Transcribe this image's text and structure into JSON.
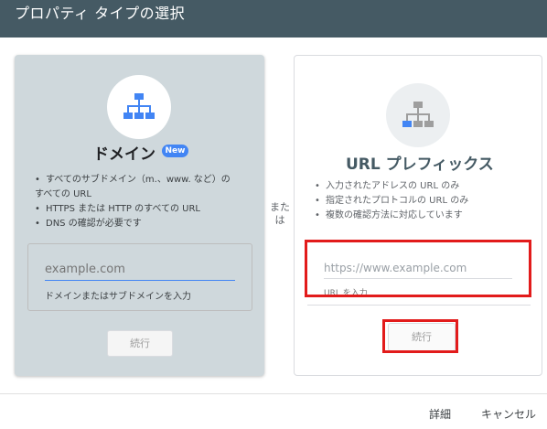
{
  "dialog": {
    "title": "プロパティ タイプの選択"
  },
  "domain_card": {
    "title": "ドメイン",
    "badge": "New",
    "bullets": [
      [
        "すべてのサブドメイン（m.、www. など）の",
        "すべての URL"
      ],
      "HTTPS または HTTP のすべての URL",
      "DNS の確認が必要です"
    ],
    "input_placeholder": "example.com",
    "input_value": "",
    "helper": "ドメインまたはサブドメインを入力",
    "continue_label": "続行"
  },
  "separator": {
    "line1": "また",
    "line2": "は"
  },
  "url_card": {
    "title": "URL プレフィックス",
    "bullets": [
      "入力されたアドレスの URL のみ",
      "指定されたプロトコルの URL のみ",
      "複数の確認方法に対応しています"
    ],
    "input_placeholder": "https://www.example.com",
    "input_value": "",
    "helper": "URL を入力",
    "continue_label": "続行"
  },
  "footer": {
    "details_label": "詳細",
    "cancel_label": "キャンセル"
  },
  "icons": {
    "domain": "sitemap-icon",
    "url_prefix": "sitemap-icon"
  },
  "colors": {
    "header_bg": "#455a64",
    "selected_card_bg": "#cfd8dc",
    "accent_blue": "#4285f4",
    "highlight_red": "#e21b1b"
  }
}
